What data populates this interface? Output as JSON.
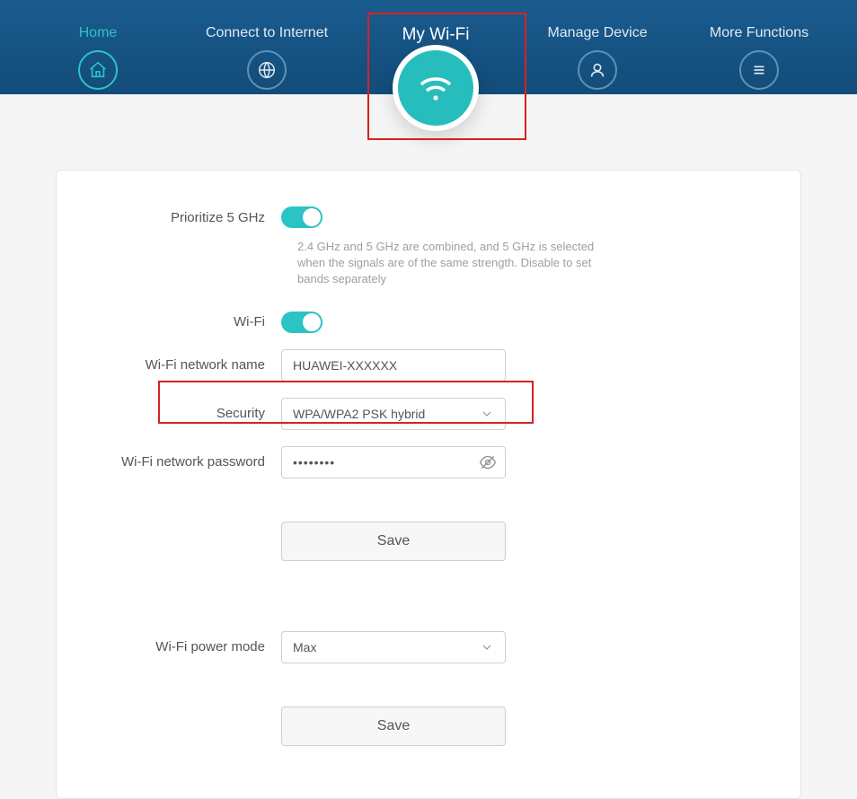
{
  "nav": {
    "home": "Home",
    "connect": "Connect to Internet",
    "wifi": "My Wi-Fi",
    "manage": "Manage Device",
    "more": "More Functions"
  },
  "form": {
    "prioritize_label": "Prioritize 5 GHz",
    "prioritize_help": "2.4 GHz and 5 GHz are combined, and 5 GHz is selected when the signals are of the same strength. Disable to set bands separately",
    "wifi_label": "Wi-Fi",
    "name_label": "Wi-Fi network name",
    "name_value": "HUAWEI-XXXXXX",
    "security_label": "Security",
    "security_value": "WPA/WPA2 PSK hybrid",
    "password_label": "Wi-Fi network password",
    "password_value": "••••••••",
    "save1": "Save",
    "power_label": "Wi-Fi power mode",
    "power_value": "Max",
    "save2": "Save"
  }
}
